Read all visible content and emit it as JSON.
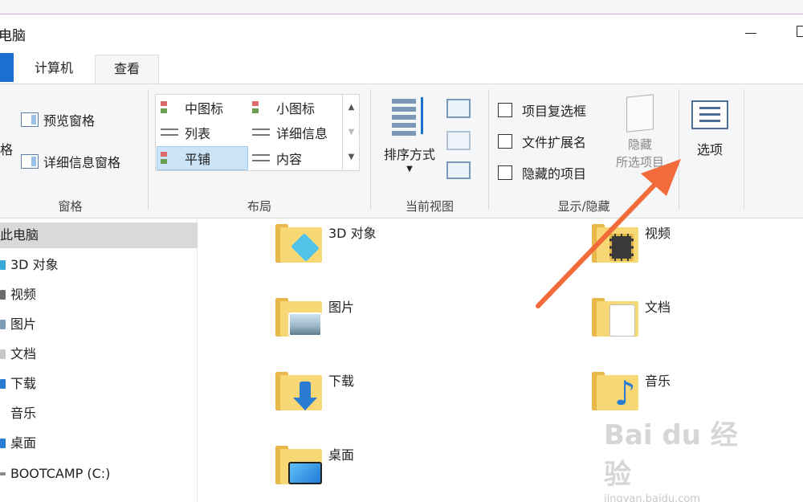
{
  "window": {
    "title": "电脑"
  },
  "tabs": [
    {
      "label": "计算机"
    },
    {
      "label": "查看"
    }
  ],
  "ribbon": {
    "panes": {
      "partial_label": "格",
      "preview_pane": "预览窗格",
      "details_pane": "详细信息窗格",
      "group_label": "窗格"
    },
    "layout": {
      "items": [
        "中图标",
        "小图标",
        "列表",
        "详细信息",
        "平铺",
        "内容"
      ],
      "selected": "平铺",
      "group_label": "布局"
    },
    "current_view": {
      "sort_label": "排序方式",
      "group_label": "当前视图"
    },
    "show_hide": {
      "checkboxes": [
        "项目复选框",
        "文件扩展名",
        "隐藏的项目"
      ],
      "hide_label_1": "隐藏",
      "hide_label_2": "所选项目",
      "group_label": "显示/隐藏"
    },
    "options": {
      "label": "选项"
    }
  },
  "nav": {
    "items": [
      "此电脑",
      "3D 对象",
      "视频",
      "图片",
      "文档",
      "下载",
      "音乐",
      "桌面",
      "BOOTCAMP (C:)"
    ]
  },
  "folders": [
    "3D 对象",
    "视频",
    "图片",
    "文档",
    "下载",
    "音乐",
    "桌面"
  ],
  "watermark": {
    "logo": "Bai du 经验",
    "url": "jingyan.baidu.com"
  },
  "colors": {
    "accent": "#1a6fd0",
    "selected_bg": "#cce4f7",
    "arrow": "#f26b3a",
    "folder": "#f8d775"
  }
}
